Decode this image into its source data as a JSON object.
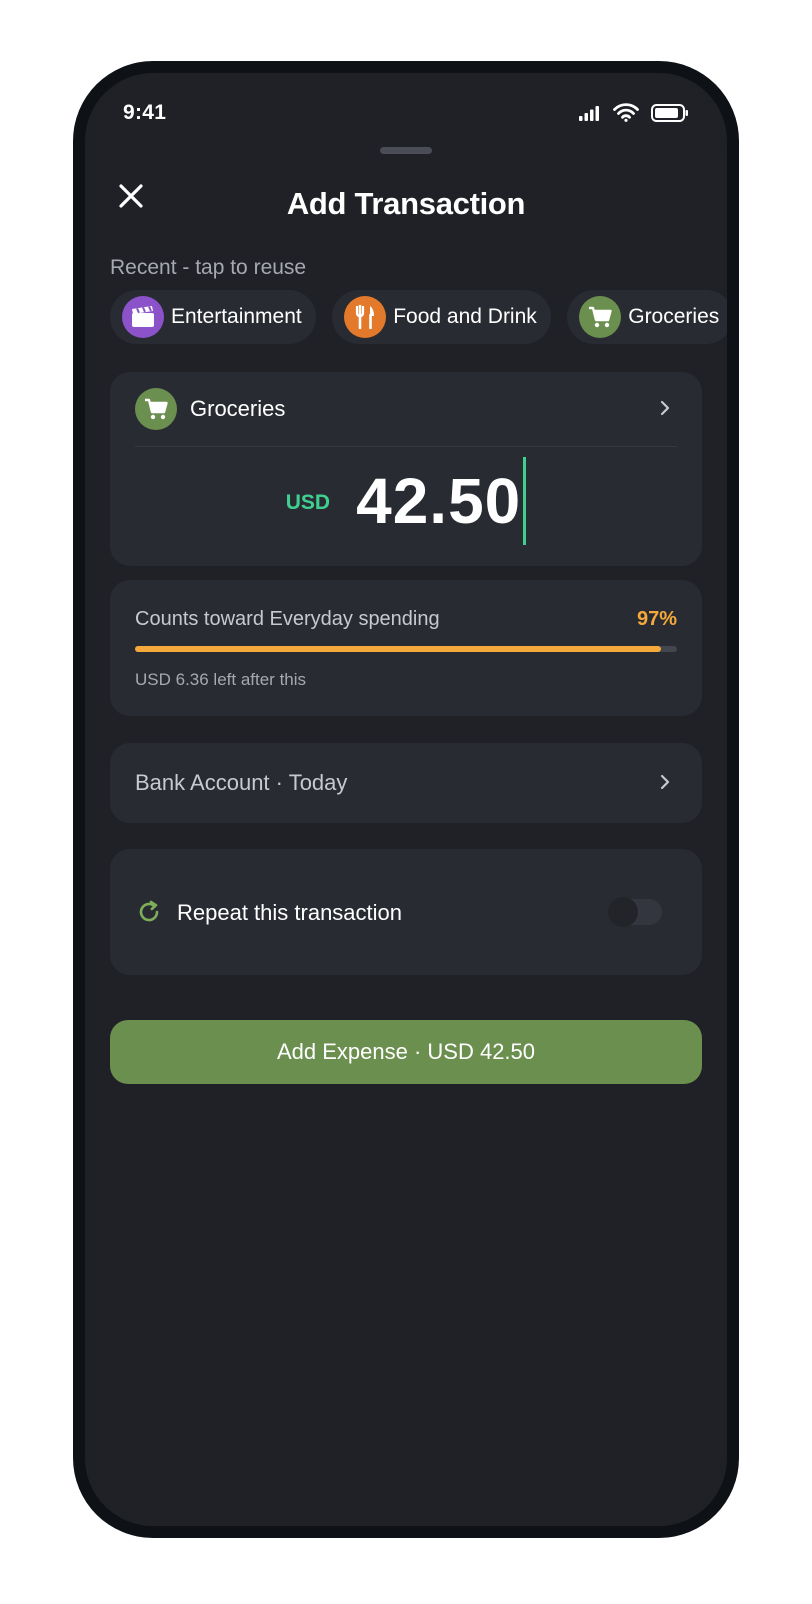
{
  "status": {
    "time": "9:41"
  },
  "header": {
    "title": "Add Transaction"
  },
  "recent": {
    "label": "Recent - tap to reuse",
    "chips": [
      {
        "label": "Entertainment",
        "icon": "clapperboard-icon",
        "color": "#8b52c9"
      },
      {
        "label": "Food and Drink",
        "icon": "fork-knife-icon",
        "color": "#e3792a"
      },
      {
        "label": "Groceries",
        "icon": "cart-icon",
        "color": "#6b8f4e"
      }
    ]
  },
  "entry": {
    "category": "Groceries",
    "category_icon": "cart-icon",
    "currency": "USD",
    "amount": "42.50"
  },
  "budget": {
    "label": "Counts toward Everyday spending",
    "percent_label": "97%",
    "percent": 0.97,
    "note": "USD 6.36 left after this"
  },
  "account": {
    "label": "Bank Account · Today"
  },
  "repeat": {
    "label": "Repeat this transaction",
    "enabled": false
  },
  "cta": {
    "label": "Add Expense · USD 42.50"
  },
  "colors": {
    "accent": "#6b8f4e",
    "amount_accent": "#3fd08f",
    "budget_warning": "#f5a93a",
    "background": "#1f2127",
    "card": "#292b33"
  }
}
